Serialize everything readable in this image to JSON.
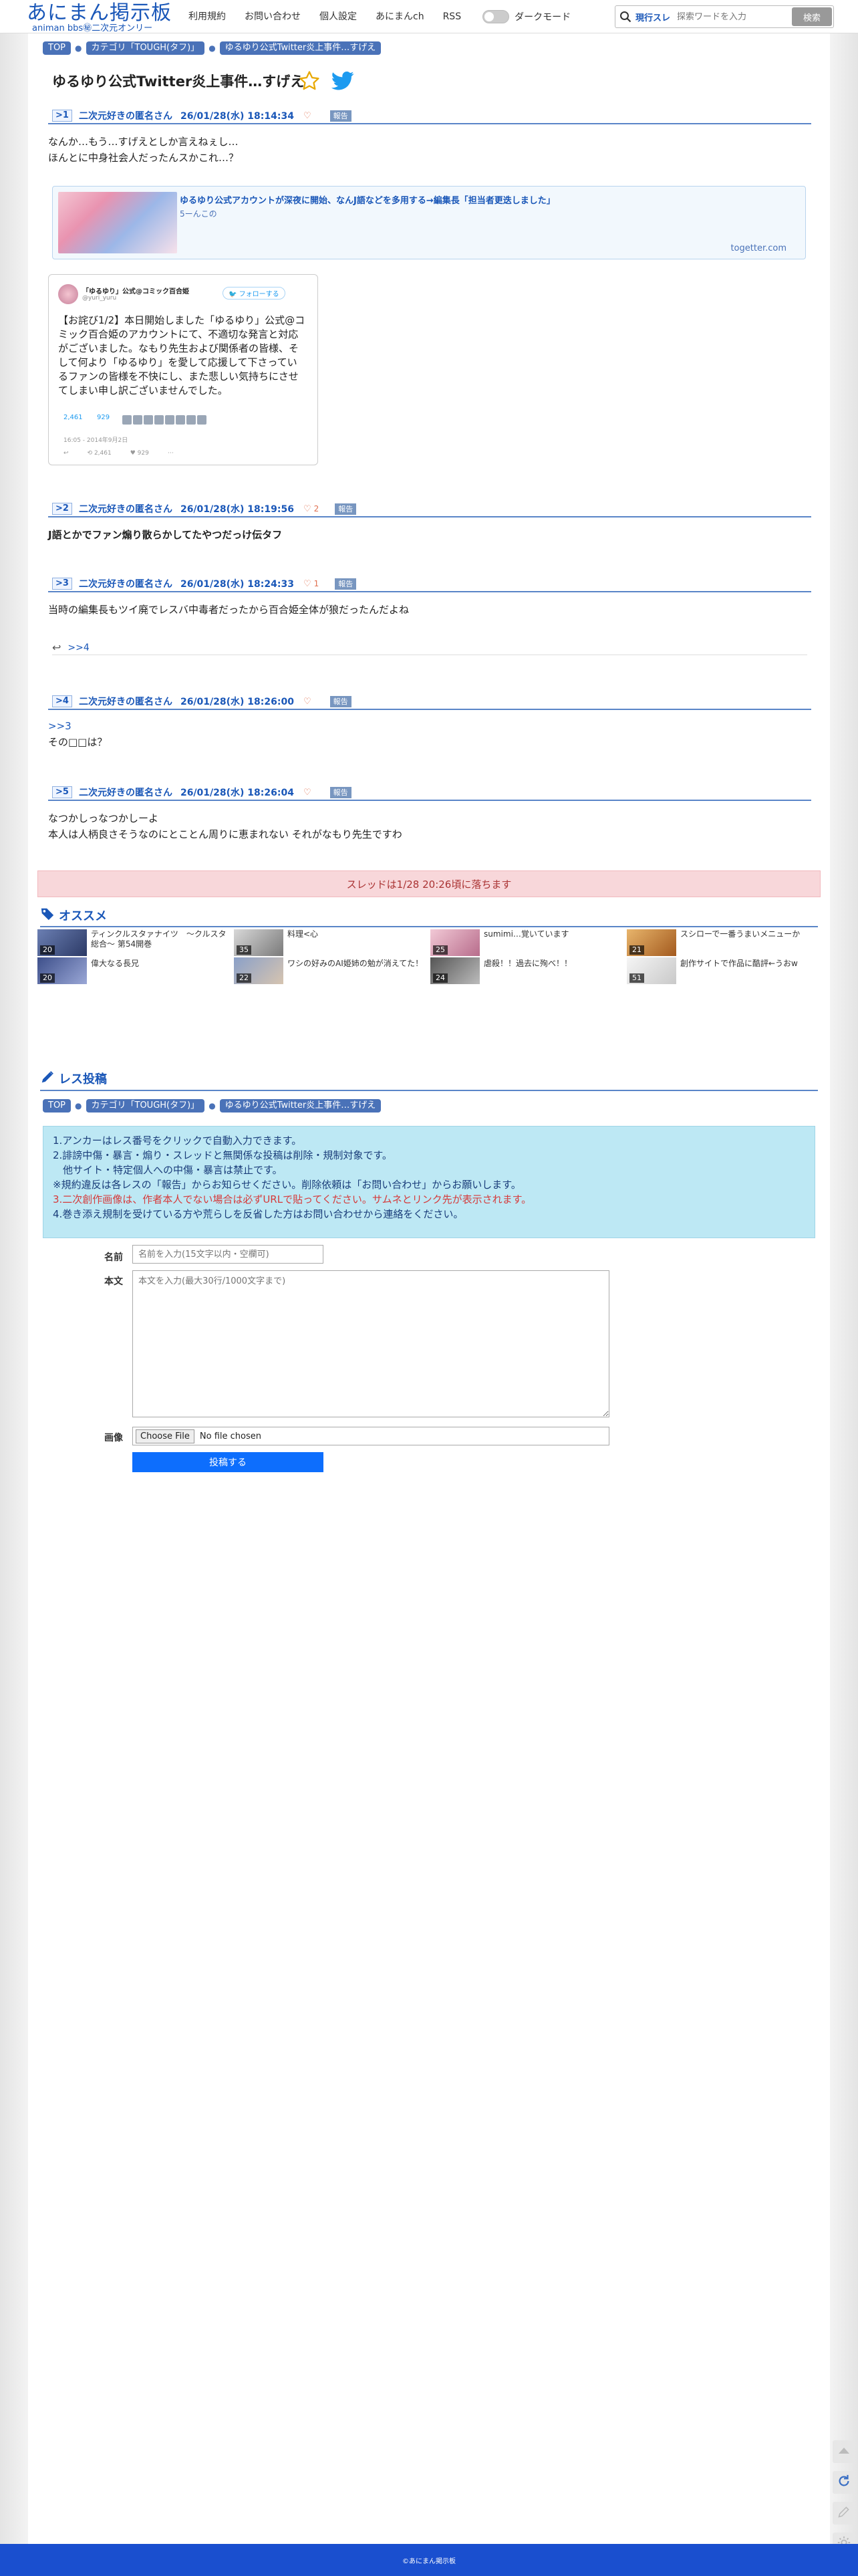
{
  "header": {
    "logo": "あにまん掲示板",
    "logo_sub": "animan bbs㊙二次元オンリー",
    "nav": [
      "利用規約",
      "お問い合わせ",
      "個人設定",
      "あにまんch",
      "RSS"
    ],
    "darkmode_label": "ダークモード",
    "search_scope": "現行スレ",
    "search_placeholder": "探索ワードを入力",
    "search_button": "検索"
  },
  "breadcrumb": [
    "TOP",
    "カテゴリ「TOUGH(タフ)」",
    "ゆるゆり公式Twitter炎上事件…すげえ"
  ],
  "thread": {
    "title": "ゆるゆり公式Twitter炎上事件…すげえ"
  },
  "posts": [
    {
      "no": ">1",
      "name": "二次元好きの匿名さん",
      "date": "26/01/28(水) 18:14:34",
      "likes": "",
      "report": "報告",
      "body": [
        "なんか…もう…すげえとしか言えねぇし…",
        "ほんとに中身社会人だったんスかこれ…？"
      ]
    },
    {
      "no": ">2",
      "name": "二次元好きの匿名さん",
      "date": "26/01/28(水) 18:19:56",
      "likes": "2",
      "report": "報告",
      "body": [
        "J語とかでファン煽り散らかしてたやつだっけ伝タフ"
      ]
    },
    {
      "no": ">3",
      "name": "二次元好きの匿名さん",
      "date": "26/01/28(水) 18:24:33",
      "likes": "1",
      "report": "報告",
      "body": [
        "当時の編集長もツイ廃でレスバ中毒者だったから百合姫全体が狼だったんだよね"
      ]
    },
    {
      "no": ">4",
      "name": "二次元好きの匿名さん",
      "date": "26/01/28(水) 18:26:00",
      "likes": "",
      "report": "報告",
      "body": [
        ">>3",
        "その□□は？"
      ]
    },
    {
      "no": ">5",
      "name": "二次元好きの匿名さん",
      "date": "26/01/28(水) 18:26:04",
      "likes": "",
      "report": "報告",
      "body": [
        "なつかしっなつかしーよ",
        "本人は人柄良さそうなのにとことん周りに恵まれない それがなもり先生ですわ"
      ]
    }
  ],
  "link_card": {
    "title": "ゆるゆり公式アカウントが深夜に開始、なんJ語などを多用する→編集長「担当者更迭しました」",
    "count": "5ーんこの",
    "domain": "togetter.com"
  },
  "tweet": {
    "name": "「ゆるゆり」公式@コミック百合姫",
    "handle": "@yuri_yuru",
    "follow": "フォローする",
    "text": "【お詫び1/2】本日開始しました「ゆるゆり」公式@コミック百合姫のアカウントにて、不適切な発言と対応がございました。なもり先生および関係者の皆様、そして何より「ゆるゆり」を愛して応援して下さっているファンの皆様を不快にし、また悲しい気持ちにさせてしまい申し訳ございませんでした。",
    "retweets": "2,461",
    "favorites": "929",
    "date": "16:05 - 2014年9月2日",
    "actions": [
      "↩",
      "⟲ 2,461",
      "♥ 929",
      "⋯"
    ]
  },
  "reply_anchor": ">>4",
  "thread_end": "スレッドは1/28 20:26頃に落ちます",
  "osusume": {
    "title": "オススメ",
    "items": [
      {
        "t1": "ティンクルスタァナイツ　〜クルスタ総合〜 第54開巻",
        "b1": "20",
        "t2": "偉大なる長兄",
        "b2": "20"
      },
      {
        "t1": "料理<心",
        "b1": "35",
        "t2": "ワシの好みのAI姫姉の勉が消えてた！",
        "b2": "22"
      },
      {
        "t1": "sumimi…覚いています",
        "b1": "25",
        "t2": "虐殺！！過去に殉べ！！",
        "b2": "24"
      },
      {
        "t1": "スシローで一番うまいメニューか",
        "b1": "21",
        "t2": "創作サイトで作品に酷評←うおw",
        "b2": "51"
      }
    ]
  },
  "post_form": {
    "title": "レス投稿",
    "rules": [
      "1.アンカーはレス番号をクリックで自動入力できます。",
      "2.誹謗中傷・暴言・煽り・スレッドと無関係な投稿は削除・規制対象です。",
      "　他サイト・特定個人への中傷・暴言は禁止です。",
      "※規約違反は各レスの「報告」からお知らせください。削除依頼は「お問い合わせ」からお願いします。",
      "3.二次創作画像は、作者本人でない場合は必ずURLで貼ってください。サムネとリンク先が表示されます。",
      "4.巻き添え規制を受けている方や荒らしを反省した方はお問い合わせから連絡をください。"
    ],
    "name_label": "名前",
    "name_placeholder": "名前を入力(15文字以内・空欄可)",
    "body_label": "本文",
    "body_placeholder": "本文を入力(最大30行/1000文字まで)",
    "image_label": "画像",
    "file_button": "Choose File",
    "file_text": "No file chosen",
    "submit": "投稿する"
  },
  "footer": "©あにまん掲示板",
  "colors": {
    "accent": "#1a57b8",
    "submit": "#0d6efd",
    "footer": "#1a4fcf",
    "rules_bg": "#bde8f4",
    "end_bg": "#f8d7da"
  }
}
